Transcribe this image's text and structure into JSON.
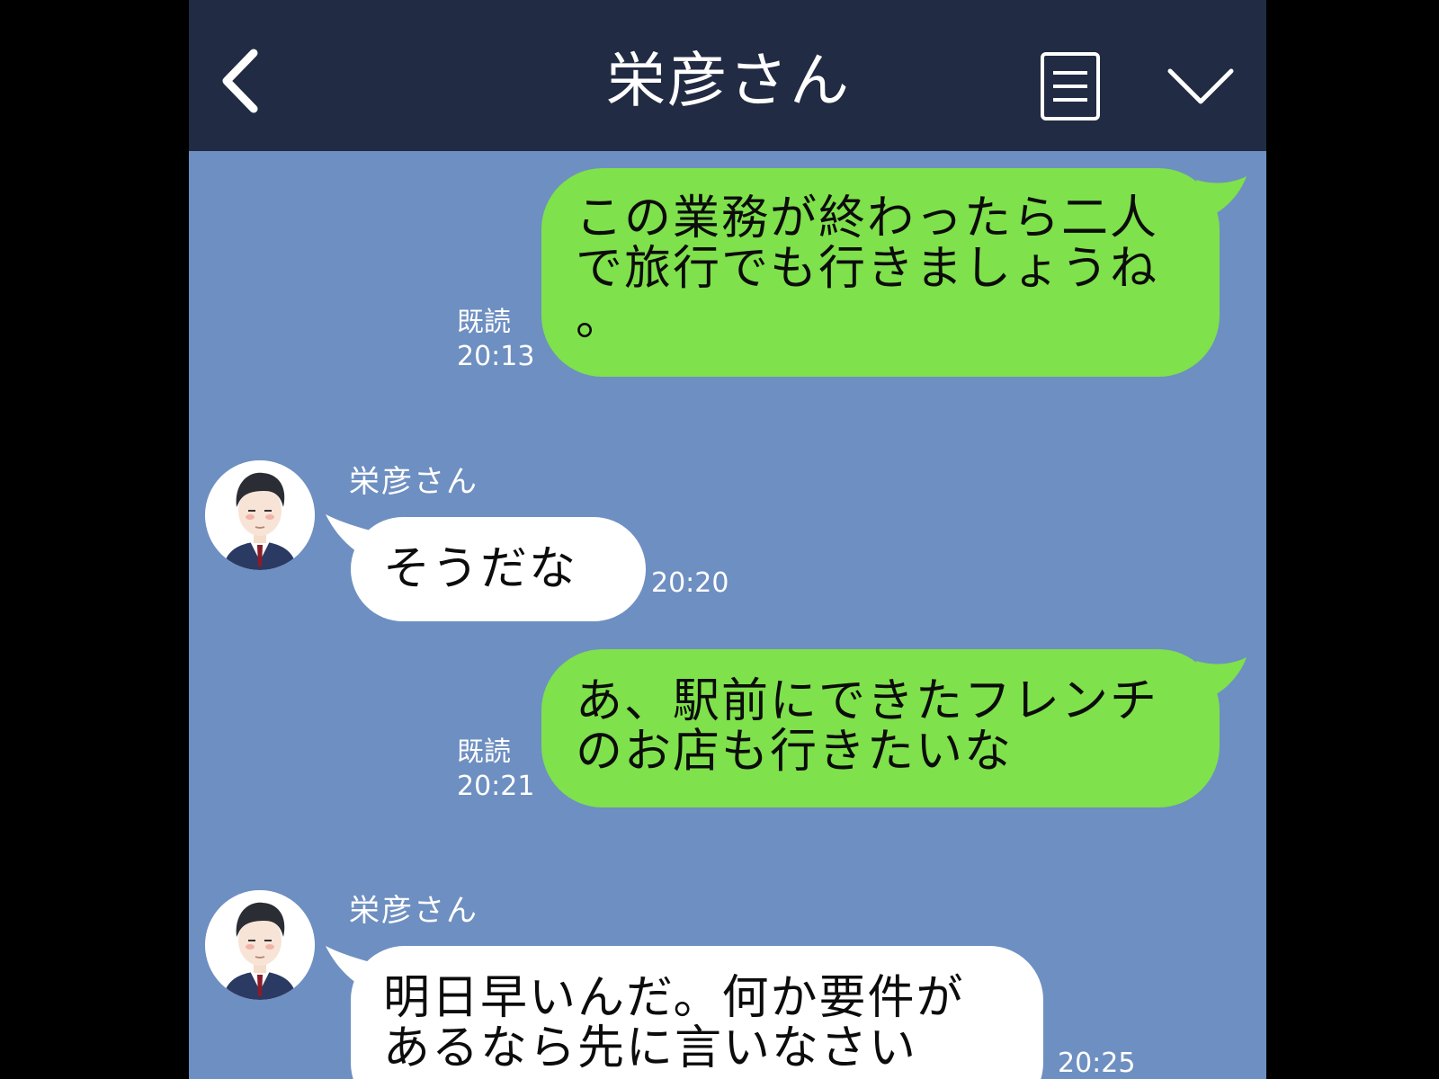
{
  "header": {
    "title": "栄彦さん",
    "back_icon": "chevron-left-icon",
    "menu_icon": "list-icon",
    "expand_icon": "chevron-down-icon"
  },
  "messages": [
    {
      "direction": "outgoing",
      "text": "この業務が終わったら二人\nで旅行でも行きましょうね\n。",
      "read_label": "既読",
      "time": "20:13"
    },
    {
      "direction": "incoming",
      "sender": "栄彦さん",
      "text": "そうだな",
      "time": "20:20"
    },
    {
      "direction": "outgoing",
      "text": "あ、駅前にできたフレンチ\nのお店も行きたいな",
      "read_label": "既読",
      "time": "20:21"
    },
    {
      "direction": "incoming",
      "sender": "栄彦さん",
      "text": "明日早いんだ。何か要件が\nあるなら先に言いなさい",
      "time": "20:25"
    }
  ],
  "colors": {
    "header_bg": "#212b43",
    "chat_bg": "#6e8fc1",
    "outgoing_bubble": "#7fe14b",
    "incoming_bubble": "#ffffff"
  }
}
